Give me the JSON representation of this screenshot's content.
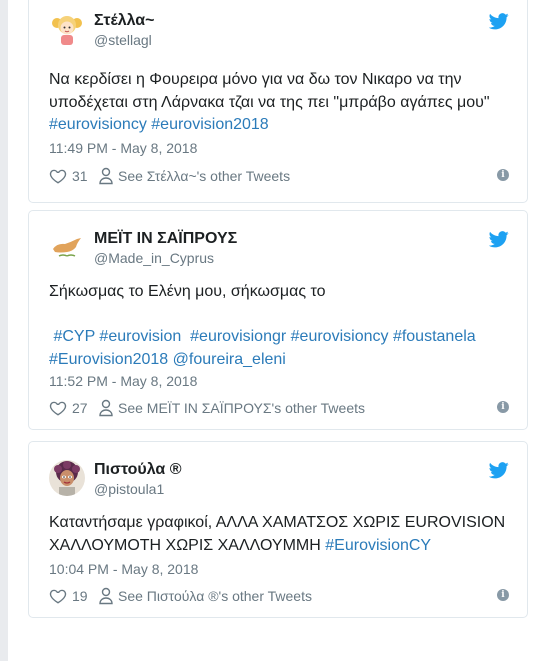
{
  "colors": {
    "link": "#2b7bb9",
    "text": "#1c2022",
    "muted": "#697882",
    "twitter_blue": "#1da1f2",
    "border": "#e1e8ed"
  },
  "tweets": [
    {
      "name": "Στέλλα~",
      "handle": "@stellagl",
      "text_plain": "Να κερδίσει η Φουρειρα μόνο για να δω τον Νικαρο να την υποδέχεται στη Λάρνακα τζαι να της πει \"μπράβο αγάπες μου\"",
      "hashtags": [
        "#eurovisioncy",
        "#eurovision2018"
      ],
      "timestamp": "11:49 PM - May 8, 2018",
      "likes": "31",
      "see_other": "See Στέλλα~'s other Tweets",
      "avatar_icon": "cartoon-girl-avatar"
    },
    {
      "name": "ΜΕΪΤ ΙΝ ΣΑΪΠΡΟΥΣ",
      "handle": "@Made_in_Cyprus",
      "text_plain": "Σήκωσμας το Ελένη μου, σήκωσμας το",
      "hashtags": [
        "#CYP",
        "#eurovision",
        "#eurovisiongr",
        "#eurovisioncy",
        "#foustanela",
        "#Eurovision2018",
        "@foureira_eleni"
      ],
      "timestamp": "11:52 PM - May 8, 2018",
      "likes": "27",
      "see_other": "See ΜΕΪΤ ΙΝ ΣΑΪΠΡΟΥΣ's other Tweets",
      "avatar_icon": "cyprus-map-avatar"
    },
    {
      "name": "Πιστούλα ®",
      "handle": "@pistoula1",
      "text_plain": "Καταντήσαμε γραφικοί, ΑΛΛΑ ΧΑΜΑΤΣΟΣ ΧΩΡΙΣ EUROVISION ΧΑΛΛΟΥΜΟΤΗ ΧΩΡΙΣ ΧΑΛΛΟΥΜΜΗ",
      "hashtags": [
        "#EurovisionCY"
      ],
      "timestamp": "10:04 PM - May 8, 2018",
      "likes": "19",
      "see_other": "See Πιστούλα ®'s other Tweets",
      "avatar_icon": "woman-photo-avatar"
    }
  ]
}
